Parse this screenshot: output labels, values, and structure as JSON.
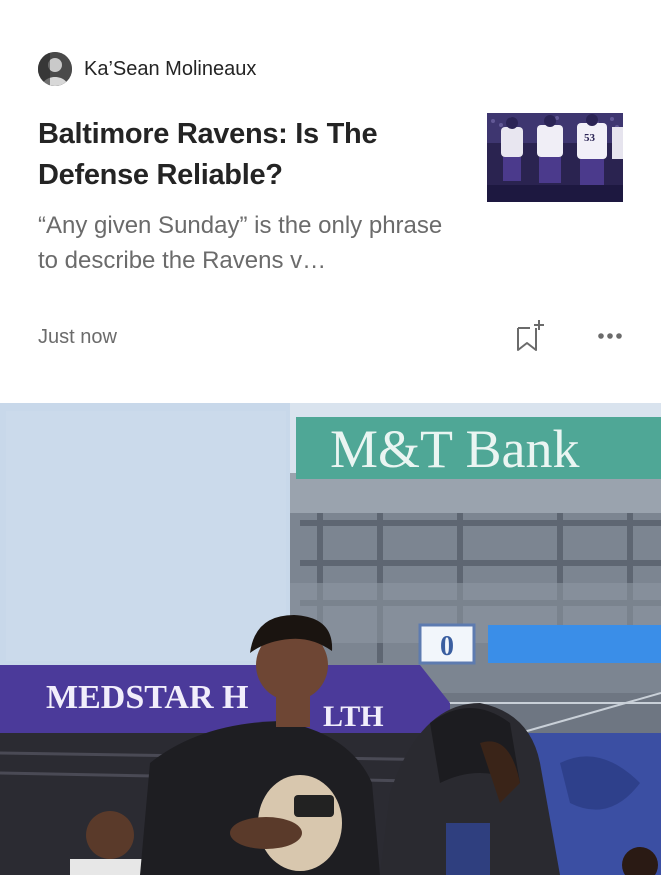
{
  "author": {
    "name": "Ka’Sean Molineaux"
  },
  "article": {
    "title": "Baltimore Ravens: Is The Defense Reliable?",
    "excerpt": "“Any given Sunday” is the only phrase to describe the Ravens v…",
    "published": "Just now"
  },
  "thumbnail": {
    "jersey_numbers": [
      "53"
    ]
  },
  "actions": {
    "bookmark_icon": "bookmark-add-icon",
    "more_icon": "more-horizontal-icon"
  },
  "hero_image": {
    "signs": {
      "bank": "M&T Bank",
      "medstar": "MEDSTAR H",
      "medstar_tail": "LTH"
    },
    "scoreboard_digit": "0"
  },
  "colors": {
    "title": "#242424",
    "secondary_text": "#6b6b6b",
    "bank_sign": "#4fa796",
    "medstar_banner": "#4b3a9a"
  }
}
